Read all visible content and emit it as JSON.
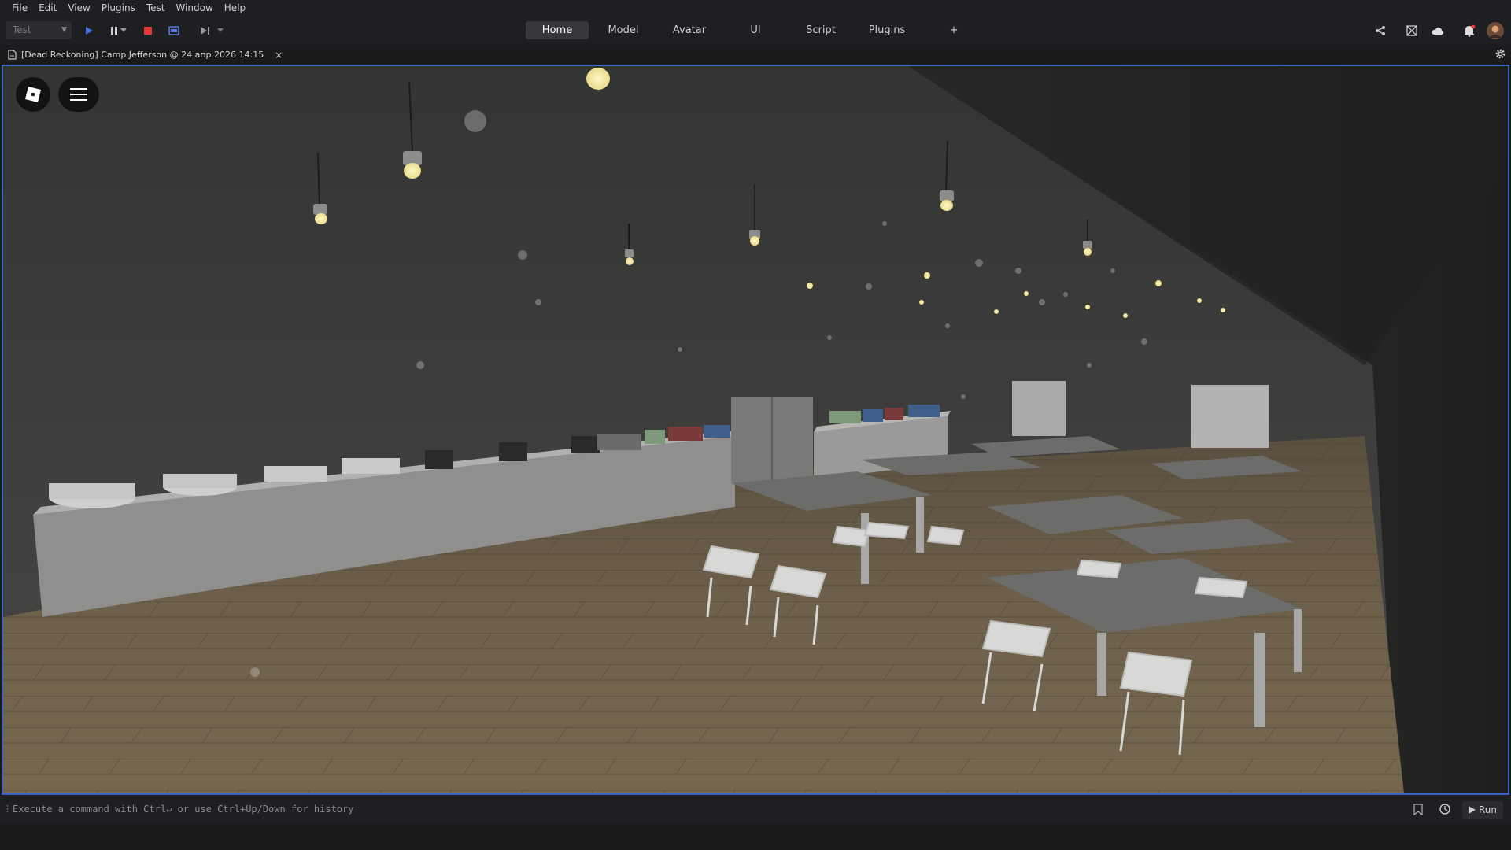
{
  "menu": [
    "File",
    "Edit",
    "View",
    "Plugins",
    "Test",
    "Window",
    "Help"
  ],
  "toolbar": {
    "mode": "Test",
    "icons": [
      "play-icon",
      "pause-icon",
      "stop-icon",
      "server-icon",
      "step-icon"
    ]
  },
  "tabs": [
    "Home",
    "Model",
    "Avatar",
    "UI",
    "Script",
    "Plugins",
    "+"
  ],
  "active_tab": "Home",
  "right_icons": [
    "share-icon",
    "collaborate-icon",
    "cloud-icon",
    "notification-bell-icon",
    "avatar"
  ],
  "document_tab": {
    "title": "[Dead Reckoning] Camp Jefferson @ 24 апр 2026 14:15",
    "close": "×"
  },
  "command_bar": {
    "placeholder": "Execute a command with Ctrl↵ or use Ctrl+Up/Down for history",
    "run_label": "Run"
  },
  "colors": {
    "accent": "#3d63c7",
    "record": "#e53935",
    "play": "#3d6fe0"
  }
}
